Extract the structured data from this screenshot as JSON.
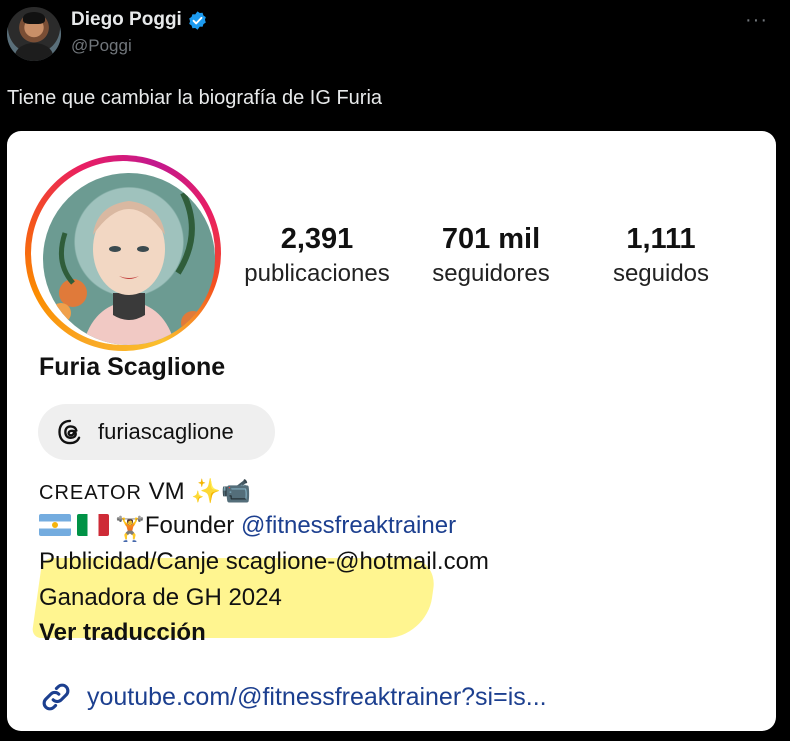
{
  "tweet": {
    "author_name": "Diego Poggi",
    "handle": "@Poggi",
    "text": "Tiene que cambiar la biografía de IG Furia",
    "more_glyph": "···",
    "verified_color": "#1d9bf0"
  },
  "profile": {
    "name": "Furia Scaglione",
    "stats": [
      {
        "value": "2,391",
        "label": "publicaciones"
      },
      {
        "value": "701 mil",
        "label": "seguidores"
      },
      {
        "value": "1,111",
        "label": "seguidos"
      }
    ],
    "threads_handle": "furiascaglione",
    "bio": {
      "line1_caps": "CREATOR",
      "line1_rest": " VM ",
      "line1_emoji": "✨📹",
      "line2_emoji": "🏋",
      "line2_text": "Founder ",
      "line2_mention": "@fitnessfreaktrainer",
      "line3": "Publicidad/Canje scaglione-@hotmail.com",
      "line4": "Ganadora de GH 2024"
    },
    "translate_label": "Ver traducción",
    "link": "youtube.com/@fitnessfreaktrainer?si=is...",
    "highlight_color": "#fff26b",
    "link_color": "#1c3f8f"
  }
}
